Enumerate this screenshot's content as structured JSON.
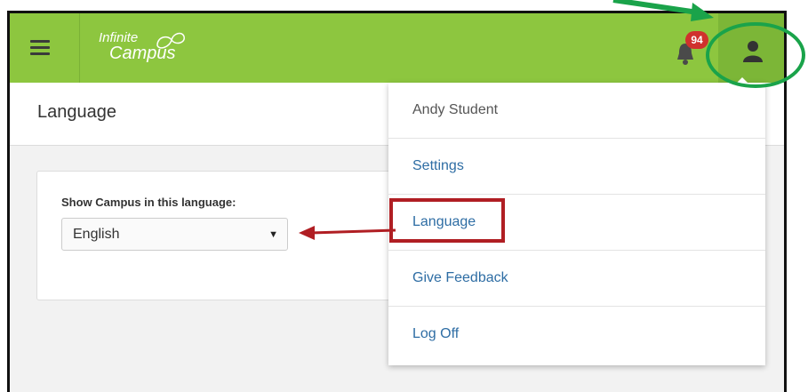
{
  "app": {
    "logo_line1": "Infinite",
    "logo_line2": "Campus"
  },
  "notifications": {
    "count": "94"
  },
  "page": {
    "title": "Language"
  },
  "language_card": {
    "label": "Show Campus in this language:",
    "selected": "English"
  },
  "user_menu": {
    "user_name": "Andy Student",
    "items": [
      {
        "label": "Settings"
      },
      {
        "label": "Language"
      },
      {
        "label": "Give Feedback"
      },
      {
        "label": "Log Off"
      }
    ]
  },
  "colors": {
    "topbar": "#8dc63f",
    "annotation_red": "#b01e23",
    "annotation_green": "#1aa34a",
    "link": "#2e6da4"
  }
}
